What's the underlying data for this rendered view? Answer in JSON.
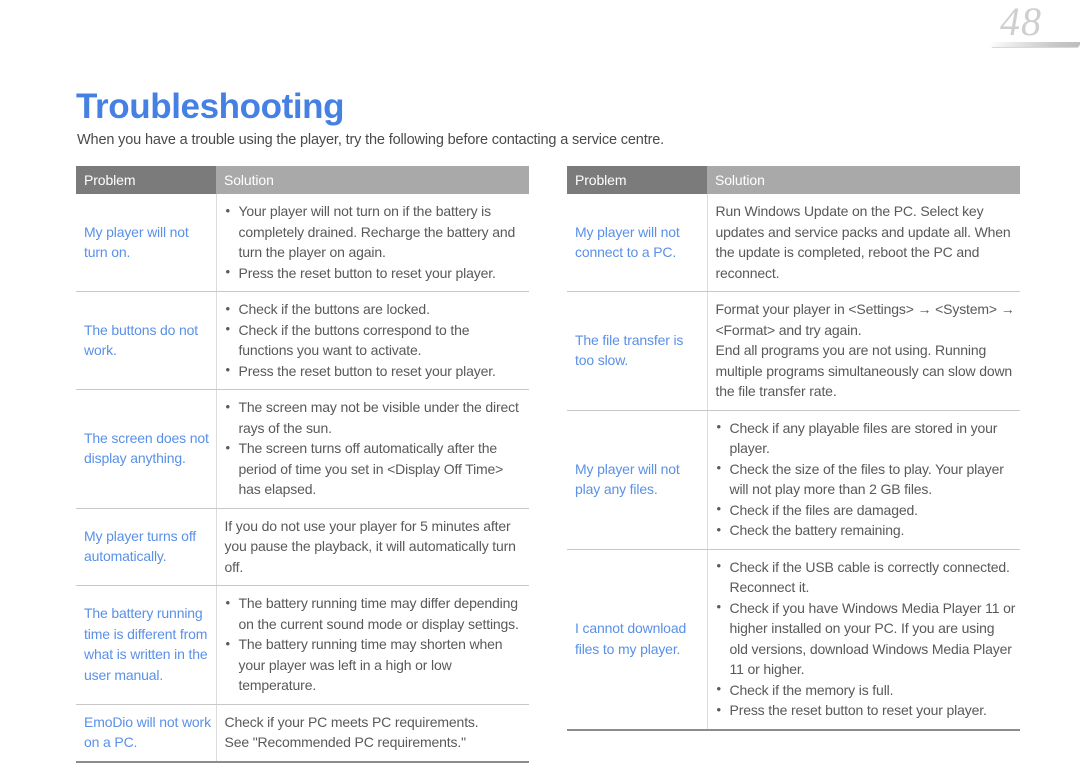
{
  "page": {
    "number": "48",
    "title": "Troubleshooting",
    "intro": "When you have a trouble using the player, try the following before contacting a service centre.",
    "accent_color": "#4580e3",
    "problem_text_color": "#5a90e8",
    "header_problem_bg": "#7b7b7b",
    "header_solution_bg": "#a9a9a9",
    "body_text_color": "#58595b"
  },
  "tables": [
    {
      "id": "left-table",
      "headers": {
        "problem": "Problem",
        "solution": "Solution"
      },
      "rows": [
        {
          "problem": "My player will not turn on.",
          "bulleted": true,
          "solutions": [
            "Your player will not turn on if the battery is completely drained. Recharge the battery and turn the player on again.",
            "Press the reset button to reset your player."
          ]
        },
        {
          "problem": "The buttons do not work.",
          "bulleted": true,
          "solutions": [
            "Check if the buttons are locked.",
            "Check if the buttons correspond to the functions you want to activate.",
            "Press the reset button to reset your player."
          ]
        },
        {
          "problem": "The screen does not display anything.",
          "bulleted": true,
          "solutions": [
            "The screen may not be visible under the direct rays of the sun.",
            "The screen turns off automatically after the period of time you set in <Display Off Time> has elapsed."
          ]
        },
        {
          "problem": "My player turns off automatically.",
          "bulleted": false,
          "solutions": [
            "If you do not use your player for 5 minutes after you pause the playback, it will automatically turn off."
          ]
        },
        {
          "problem": "The battery running time is different from what is written in the user manual.",
          "bulleted": true,
          "solutions": [
            "The battery running time may differ depending on the current sound mode or display settings.",
            "The battery running time may shorten when your player was left in a high or low temperature."
          ]
        },
        {
          "problem": "EmoDio will not work on a PC.",
          "bulleted": false,
          "solutions": [
            "Check if your PC meets PC requirements.",
            "See \"Recommended PC requirements.\""
          ]
        }
      ]
    },
    {
      "id": "right-table",
      "headers": {
        "problem": "Problem",
        "solution": "Solution"
      },
      "rows": [
        {
          "problem": "My player will not connect to a PC.",
          "bulleted": false,
          "solutions": [
            "Run Windows Update on the PC. Select key updates and service packs and update all. When the update is completed, reboot the PC and reconnect."
          ]
        },
        {
          "problem": "The file transfer is too slow.",
          "bulleted": false,
          "solutions": [
            "Format your player in <Settings> → <System> → <Format> and try again.",
            "End all programs you are not using. Running multiple programs simultaneously can slow down the file transfer rate."
          ]
        },
        {
          "problem": "My player will not play any files.",
          "bulleted": true,
          "solutions": [
            "Check if any playable files are stored in your player.",
            "Check the size of the files to play. Your player will not play more than 2 GB files.",
            "Check if the files are damaged.",
            "Check the battery remaining."
          ]
        },
        {
          "problem": "I cannot download files to my player.",
          "bulleted": true,
          "solutions": [
            "Check if the USB cable is correctly connected. Reconnect it.",
            "Check if you have Windows Media Player 11 or higher installed on your PC. If you are using old versions, download Windows Media Player 11 or higher.",
            "Check if the memory is full.",
            "Press the reset button to reset your player."
          ]
        }
      ]
    }
  ]
}
